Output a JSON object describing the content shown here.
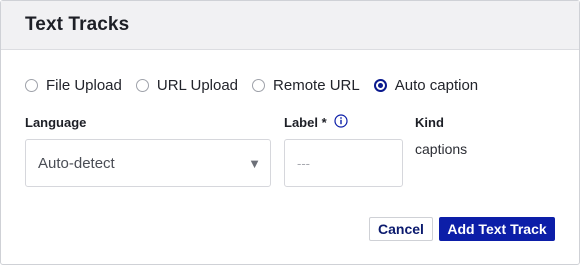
{
  "dialog": {
    "title": "Text Tracks"
  },
  "source_options": [
    {
      "label": "File Upload",
      "checked": false
    },
    {
      "label": "URL Upload",
      "checked": false
    },
    {
      "label": "Remote URL",
      "checked": false
    },
    {
      "label": "Auto caption",
      "checked": true
    }
  ],
  "language": {
    "label": "Language",
    "value": "Auto-detect",
    "caret_icon": "triangle-down-icon"
  },
  "label_field": {
    "label": "Label *",
    "placeholder": "---",
    "value": "",
    "info_icon": "info-circle-icon"
  },
  "kind": {
    "label": "Kind",
    "value": "captions"
  },
  "actions": {
    "cancel_label": "Cancel",
    "submit_label": "Add Text Track"
  },
  "colors": {
    "accent": "#0c1ea8",
    "header_bg": "#f1f1f3"
  }
}
